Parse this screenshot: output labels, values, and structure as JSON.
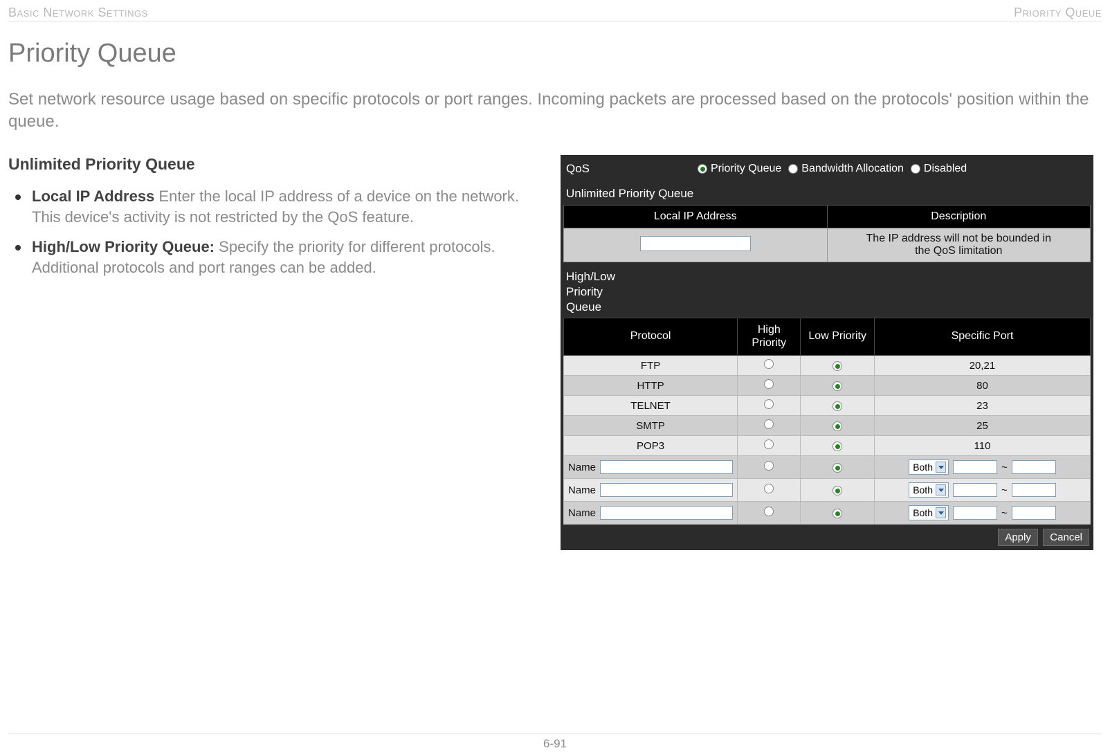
{
  "header": {
    "left": "Basic Network Settings",
    "right": "Priority Queue"
  },
  "title": "Priority Queue",
  "intro": "Set network resource usage based on specific protocols or port ranges. Incoming packets are processed based on the protocols' position within the queue.",
  "left": {
    "subhead": "Unlimited Priority Queue",
    "items": [
      {
        "strong": "Local IP Address",
        "sep": "  ",
        "rest": "Enter the local IP address of a device on the network. This device's activity is not restricted by the QoS feature."
      },
      {
        "strong": "High/Low Priority Queue:",
        "sep": " ",
        "rest": "Specify the priority for different protocols. Additional protocols and port ranges can be added."
      }
    ]
  },
  "panel": {
    "qos_label": "QoS",
    "qos_options": [
      {
        "label": "Priority Queue",
        "selected": true
      },
      {
        "label": "Bandwidth Allocation",
        "selected": false
      },
      {
        "label": "Disabled",
        "selected": false
      }
    ],
    "upq": {
      "section_label": "Unlimited Priority Queue",
      "headers": [
        "Local IP Address",
        "Description"
      ],
      "desc_line1": "The IP address will not be bounded in",
      "desc_line2": "the QoS limitation"
    },
    "hl_label_l1": "High/Low",
    "hl_label_l2": "Priority",
    "hl_label_l3": "Queue",
    "pq": {
      "headers": {
        "protocol": "Protocol",
        "high": "High Priority",
        "low": "Low Priority",
        "port": "Specific Port"
      },
      "rows": [
        {
          "protocol": "FTP",
          "high": false,
          "low": true,
          "port": "20,21"
        },
        {
          "protocol": "HTTP",
          "high": false,
          "low": true,
          "port": "80"
        },
        {
          "protocol": "TELNET",
          "high": false,
          "low": true,
          "port": "23"
        },
        {
          "protocol": "SMTP",
          "high": false,
          "low": true,
          "port": "25"
        },
        {
          "protocol": "POP3",
          "high": false,
          "low": true,
          "port": "110"
        }
      ],
      "custom_rows": [
        {
          "name_label": "Name",
          "select": "Both",
          "tilde": "~"
        },
        {
          "name_label": "Name",
          "select": "Both",
          "tilde": "~"
        },
        {
          "name_label": "Name",
          "select": "Both",
          "tilde": "~"
        }
      ]
    },
    "buttons": {
      "apply": "Apply",
      "cancel": "Cancel"
    }
  },
  "footer": "6-91"
}
